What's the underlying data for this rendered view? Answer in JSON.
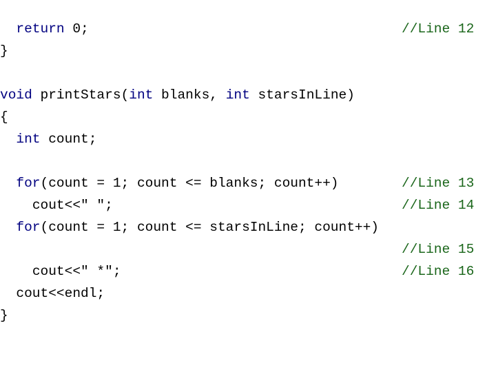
{
  "slide": {
    "kind": "code-listing",
    "language": "C++",
    "background_color": "#ffffff",
    "colors": {
      "keyword": "#000080",
      "code": "#000000",
      "comment": "#1a661a"
    },
    "lines": [
      {
        "id": "line-return-0",
        "indent": "  ",
        "tokens": [
          {
            "text": "return",
            "kind": "keyword"
          },
          {
            "text": " 0;",
            "kind": "code"
          }
        ],
        "comment": "//Line 12"
      },
      {
        "id": "line-close-main",
        "indent": "",
        "tokens": [
          {
            "text": "}",
            "kind": "code"
          }
        ],
        "comment": ""
      },
      {
        "id": "line-blank-1",
        "indent": "",
        "tokens": [],
        "comment": ""
      },
      {
        "id": "line-function-signature",
        "indent": "",
        "tokens": [
          {
            "text": "void",
            "kind": "keyword"
          },
          {
            "text": " printStars(",
            "kind": "code"
          },
          {
            "text": "int",
            "kind": "keyword"
          },
          {
            "text": " blanks, ",
            "kind": "code"
          },
          {
            "text": "int",
            "kind": "keyword"
          },
          {
            "text": " starsInLine)",
            "kind": "code"
          }
        ],
        "comment": ""
      },
      {
        "id": "line-open-function",
        "indent": "",
        "tokens": [
          {
            "text": "{",
            "kind": "code"
          }
        ],
        "comment": ""
      },
      {
        "id": "line-declare-count",
        "indent": "  ",
        "tokens": [
          {
            "text": "int",
            "kind": "keyword"
          },
          {
            "text": " count;",
            "kind": "code"
          }
        ],
        "comment": ""
      },
      {
        "id": "line-blank-2",
        "indent": "",
        "tokens": [],
        "comment": ""
      },
      {
        "id": "line-for-blanks",
        "indent": "  ",
        "tokens": [
          {
            "text": "for",
            "kind": "keyword"
          },
          {
            "text": "(count = 1; count <= blanks; count++) ",
            "kind": "code"
          }
        ],
        "comment": "//Line 13"
      },
      {
        "id": "line-cout-space",
        "indent": "    ",
        "tokens": [
          {
            "text": "cout<<\" \";",
            "kind": "code"
          }
        ],
        "comment": "//Line 14"
      },
      {
        "id": "line-for-stars",
        "indent": "  ",
        "tokens": [
          {
            "text": "for",
            "kind": "keyword"
          },
          {
            "text": "(count = 1; count <= starsInLine; count++)",
            "kind": "code"
          }
        ],
        "comment": ""
      },
      {
        "id": "line-comment-only-15",
        "indent": "",
        "tokens": [],
        "comment": "//Line 15"
      },
      {
        "id": "line-cout-star",
        "indent": "    ",
        "tokens": [
          {
            "text": "cout<<\" *\";",
            "kind": "code"
          }
        ],
        "comment": "//Line 16"
      },
      {
        "id": "line-cout-endl",
        "indent": "  ",
        "tokens": [
          {
            "text": "cout<<endl;",
            "kind": "code"
          }
        ],
        "comment": ""
      },
      {
        "id": "line-close-function",
        "indent": "",
        "tokens": [
          {
            "text": "}",
            "kind": "code"
          }
        ],
        "comment": ""
      }
    ]
  }
}
